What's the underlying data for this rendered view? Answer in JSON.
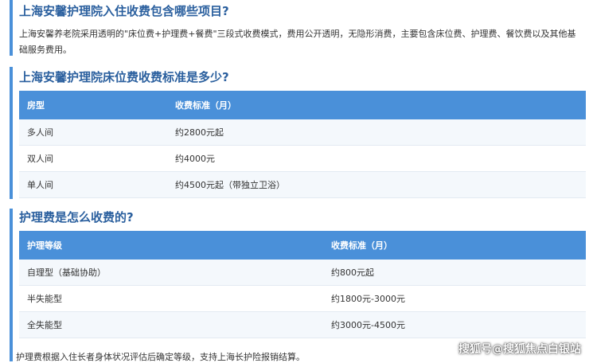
{
  "section1": {
    "title": "上海安馨护理院入住收费包含哪些项目?",
    "text": "上海安馨养老院采用透明的\"床位费+护理费+餐费\"三段式收费模式，费用公开透明，无隐形消费，主要包含床位费、护理费、餐饮费以及其他基础服务费用。"
  },
  "section2": {
    "title": "上海安馨护理院床位费收费标准是多少?",
    "headers": [
      "房型",
      "收费标准（月）"
    ],
    "rows": [
      [
        "多人间",
        "约2800元起"
      ],
      [
        "双人间",
        "约4000元"
      ],
      [
        "单人间",
        "约4500元起（带独立卫浴）"
      ]
    ]
  },
  "section3": {
    "title": "护理费是怎么收费的?",
    "headers": [
      "护理等级",
      "收费标准（月）"
    ],
    "rows": [
      [
        "自理型（基础协助）",
        "约800元起"
      ],
      [
        "半失能型",
        "约1800元-3000元"
      ],
      [
        "全失能型",
        "约3000元-4500元"
      ]
    ],
    "note": "护理费根据入住长者身体状况评估后确定等级，支持上海长护险报销结算。"
  },
  "watermark": "搜狐号@搜狐焦点白银站"
}
